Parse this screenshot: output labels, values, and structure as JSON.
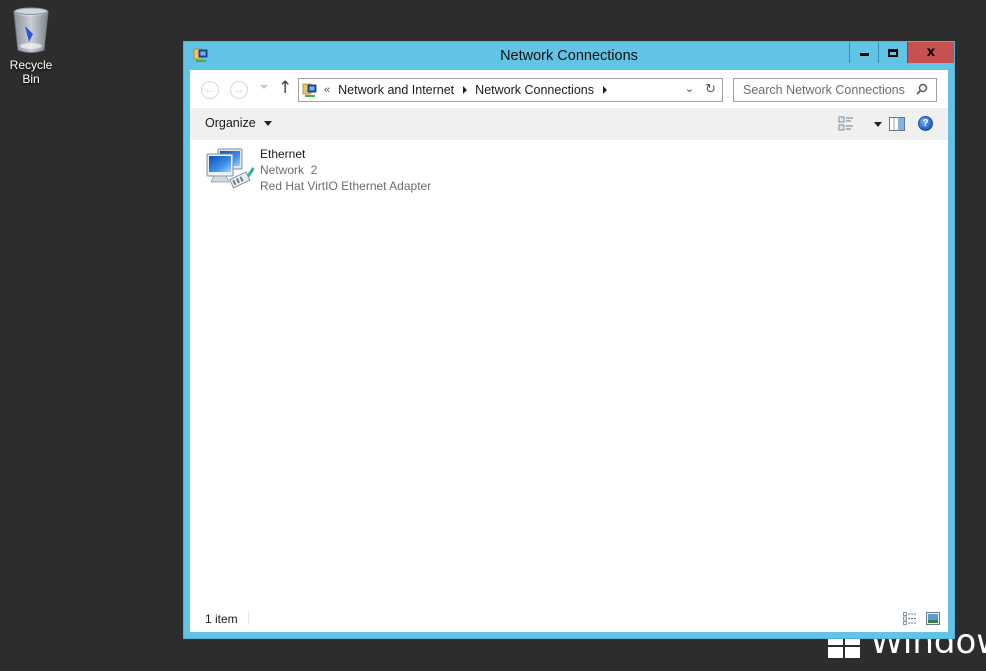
{
  "desktop": {
    "icons": [
      {
        "label": "Recycle Bin",
        "icon": "recycle-bin-icon"
      }
    ],
    "watermark": "Windows"
  },
  "window": {
    "title": "Network Connections",
    "title_icon": "network-connections-icon",
    "controls": {
      "minimize": "minimize-icon",
      "maximize": "maximize-icon",
      "close": "x"
    },
    "navigation": {
      "back": "back-arrow-icon",
      "forward": "forward-arrow-icon",
      "recent": "chevron-down-icon",
      "up": "↑"
    },
    "address": {
      "overflow": "«",
      "breadcrumbs": [
        {
          "label": "Network and Internet"
        },
        {
          "label": "Network Connections"
        }
      ],
      "dropdown": "⌄",
      "refresh": "↻"
    },
    "search": {
      "placeholder": "Search Network Connections"
    },
    "command_bar": {
      "organize_label": "Organize",
      "view_options": [
        "change-view-icon",
        "more-options-dropdown",
        "preview-pane-icon",
        "help-icon"
      ],
      "help_glyph": "?"
    },
    "items": [
      {
        "name": "Ethernet",
        "network": "Network  2",
        "adapter": "Red Hat VirtIO Ethernet Adapter",
        "icon": "ethernet-connection-icon"
      }
    ],
    "status_bar": {
      "count": "1 item",
      "views": [
        "details-view-icon",
        "large-icons-view-icon"
      ]
    }
  },
  "colors": {
    "desktop_bg": "#2d2d2d",
    "window_frame": "#62c4e4",
    "close_button": "#c75050",
    "command_bar": "#f0f0f0"
  }
}
